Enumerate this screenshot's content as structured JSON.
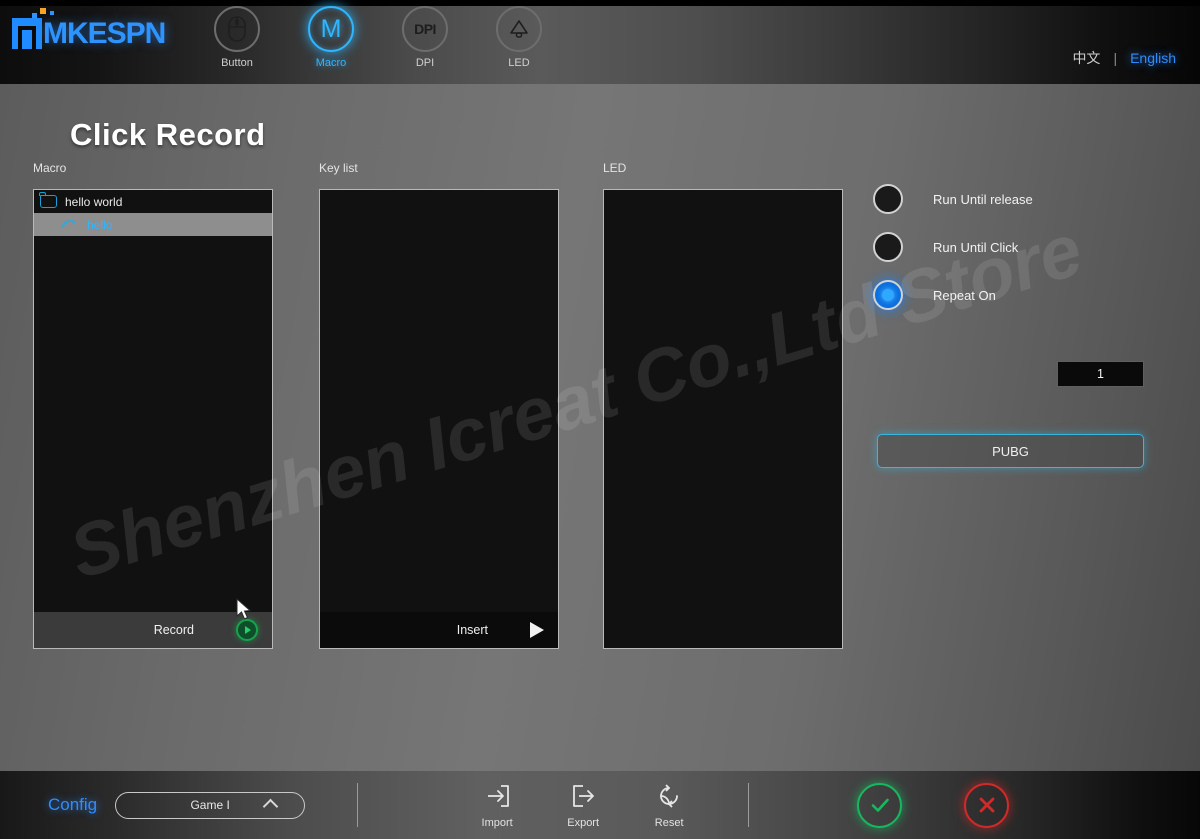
{
  "app": {
    "brand": "MKESPN",
    "annotation": "Click Record",
    "watermark": "Shenzhen Icreat Co.,Ltd Store"
  },
  "nav": {
    "tabs": [
      {
        "label": "Button",
        "icon": "mouse-icon",
        "active": false
      },
      {
        "label": "Macro",
        "icon": "macro-m-icon",
        "active": true
      },
      {
        "label": "DPI",
        "icon": "dpi-icon",
        "active": false
      },
      {
        "label": "LED",
        "icon": "lamp-icon",
        "active": false
      }
    ]
  },
  "language": {
    "chinese": "中文",
    "separator": "|",
    "english": "English",
    "selected": "English"
  },
  "panels": {
    "macro": {
      "label": "Macro",
      "items": [
        {
          "name": "hello world",
          "type": "folder",
          "selected": false
        },
        {
          "name": "hello",
          "type": "macro",
          "selected": true
        }
      ],
      "footer_label": "Record",
      "footer_icon": "record-play-icon"
    },
    "keylist": {
      "label": "Key list",
      "items": [],
      "footer_label": "Insert",
      "footer_icon": "play-triangle-icon"
    },
    "led": {
      "label": "LED",
      "items": []
    }
  },
  "options": {
    "radios": [
      {
        "label": "Run Until release",
        "selected": false
      },
      {
        "label": "Run Until Click",
        "selected": false
      },
      {
        "label": "Repeat On",
        "selected": true
      }
    ],
    "repeat_count": "1",
    "profile_button": "PUBG"
  },
  "bottom": {
    "config_label": "Config",
    "config_value": "Game I",
    "tools": [
      {
        "label": "Import",
        "icon": "import-icon"
      },
      {
        "label": "Export",
        "icon": "export-icon"
      },
      {
        "label": "Reset",
        "icon": "reset-icon"
      }
    ],
    "confirm_icon": "check-circle-icon",
    "cancel_icon": "x-circle-icon"
  },
  "colors": {
    "accent_blue": "#2f8cff",
    "accent_cyan": "#2fb6ff",
    "confirm_green": "#17b85f",
    "cancel_red": "#d02a2a",
    "panel_bg": "#111111"
  }
}
